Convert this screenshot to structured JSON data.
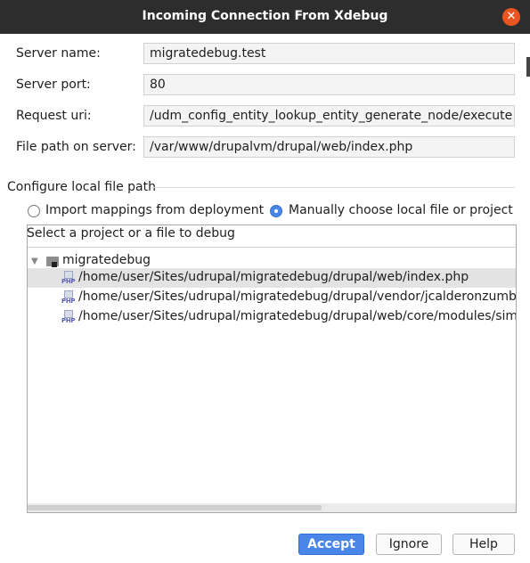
{
  "dialog": {
    "title": "Incoming Connection From Xdebug",
    "close_glyph": "✕"
  },
  "fields": {
    "server_name": {
      "label": "Server name:",
      "value": "migratedebug.test"
    },
    "server_port": {
      "label": "Server port:",
      "value": "80"
    },
    "request_uri": {
      "label": "Request uri:",
      "value": "/udm_config_entity_lookup_entity_generate_node/execute"
    },
    "file_path": {
      "label": "File path on server:",
      "value": "/var/www/drupalvm/drupal/web/index.php"
    }
  },
  "local_path": {
    "section_label": "Configure local file path",
    "option_import": "Import mappings from deployment",
    "option_manual": "Manually choose local file or project",
    "selected_option": "manual"
  },
  "tree": {
    "header": "Select a project or a file to debug",
    "root": {
      "label": "migratedebug",
      "icon": "folder-icon",
      "expanded": true
    },
    "items": [
      {
        "label": "/home/user/Sites/udrupal/migratedebug/drupal/web/index.php",
        "icon": "php-file-icon",
        "icon_text": "PHP",
        "selected": true
      },
      {
        "label": "/home/user/Sites/udrupal/migratedebug/drupal/vendor/jcalderonzumba/gastonjs/src/Client/main.php",
        "icon": "php-file-icon",
        "icon_text": "PHP",
        "selected": false
      },
      {
        "label": "/home/user/Sites/udrupal/migratedebug/drupal/web/core/modules/simpletest/tests/index.php",
        "icon": "php-file-icon",
        "icon_text": "PHP",
        "selected": false
      }
    ]
  },
  "buttons": {
    "accept": "Accept",
    "ignore": "Ignore",
    "help": "Help"
  },
  "colors": {
    "titlebar": "#2d2d2d",
    "close": "#e95420",
    "accent": "#4a86e8",
    "selection": "#e3e3e3"
  }
}
